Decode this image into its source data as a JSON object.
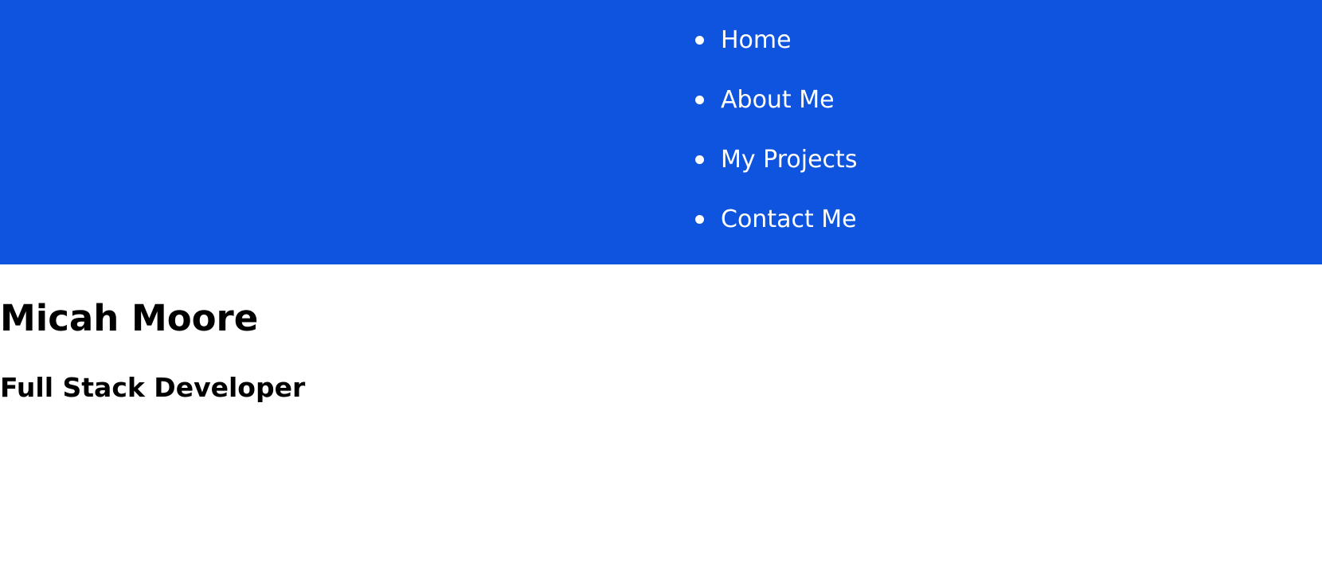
{
  "header": {
    "background_color": "#0f54df",
    "nav": {
      "items": [
        {
          "label": "Home"
        },
        {
          "label": "About Me"
        },
        {
          "label": "My Projects"
        },
        {
          "label": "Contact Me"
        }
      ]
    }
  },
  "main": {
    "name": "Micah Moore",
    "role": "Full Stack Developer"
  }
}
